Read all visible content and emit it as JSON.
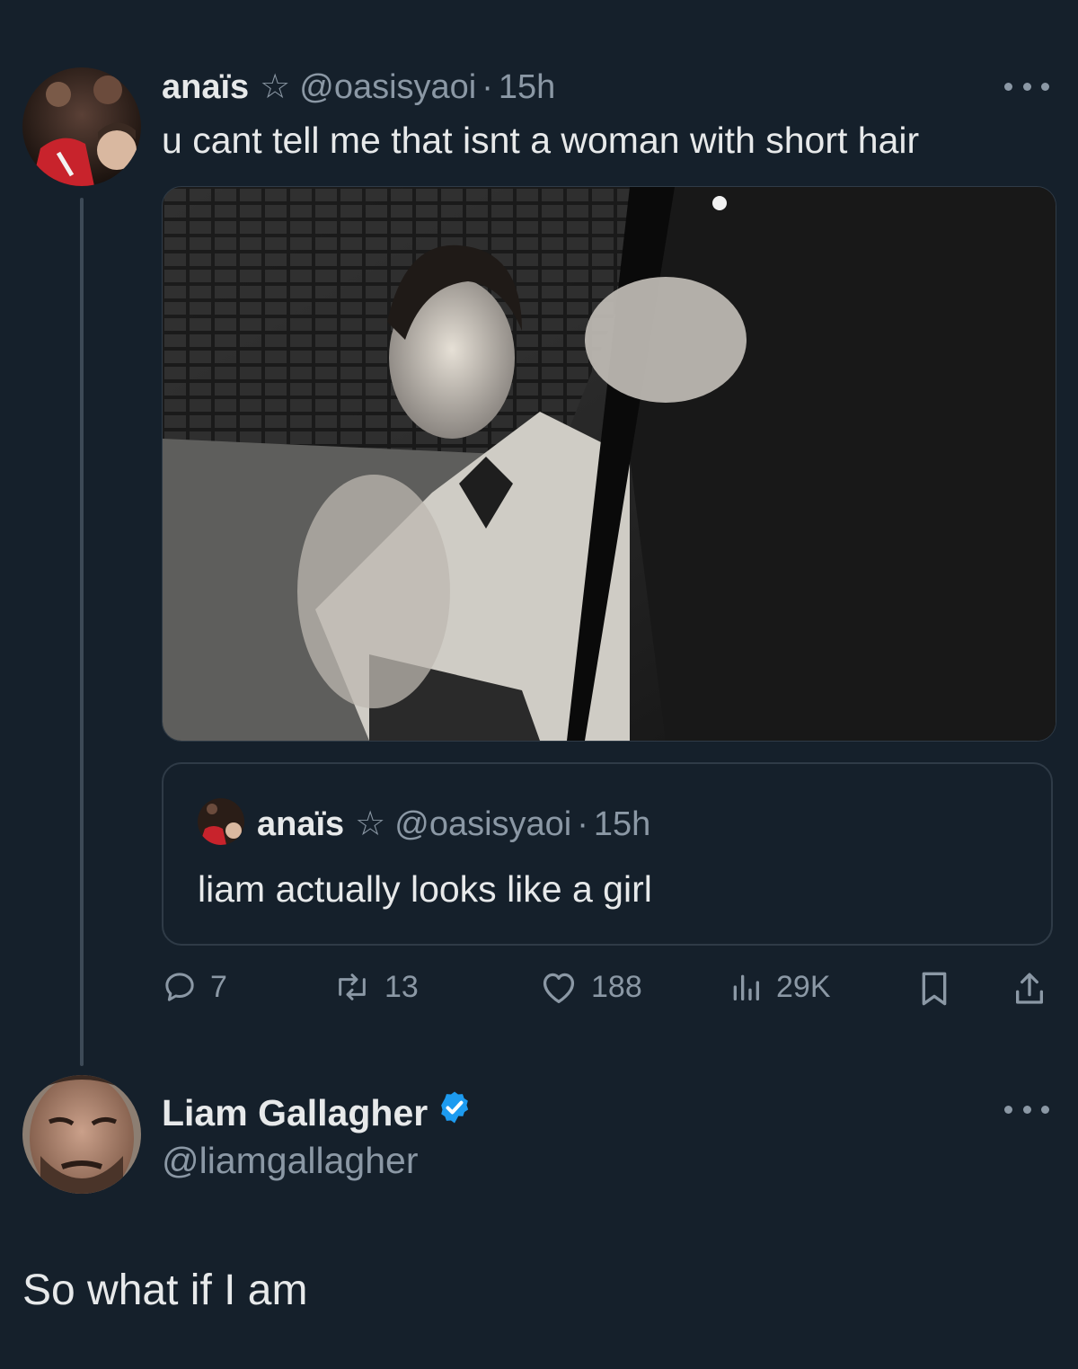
{
  "main_tweet": {
    "author_name": "anaïs",
    "star": "☆",
    "handle": "@oasisyaoi",
    "separator": "·",
    "time": "15h",
    "text": "u cant tell me that isnt a woman with short hair",
    "more_icon": "more-horizontal-icon"
  },
  "quoted_tweet": {
    "author_name": "anaïs",
    "star": "☆",
    "handle": "@oasisyaoi",
    "separator": "·",
    "time": "15h",
    "text": "liam actually looks like a girl"
  },
  "actions": {
    "replies": "7",
    "retweets": "13",
    "likes": "188",
    "views": "29K"
  },
  "reply_tweet": {
    "author_name": "Liam Gallagher",
    "handle": "@liamgallagher",
    "verified_color": "#1d9bf0",
    "text": "So what if I am"
  },
  "colors": {
    "background": "#15202b",
    "text": "#e7e9ea",
    "muted": "#8b98a5",
    "border": "#2f3b47",
    "accent": "#1d9bf0"
  }
}
